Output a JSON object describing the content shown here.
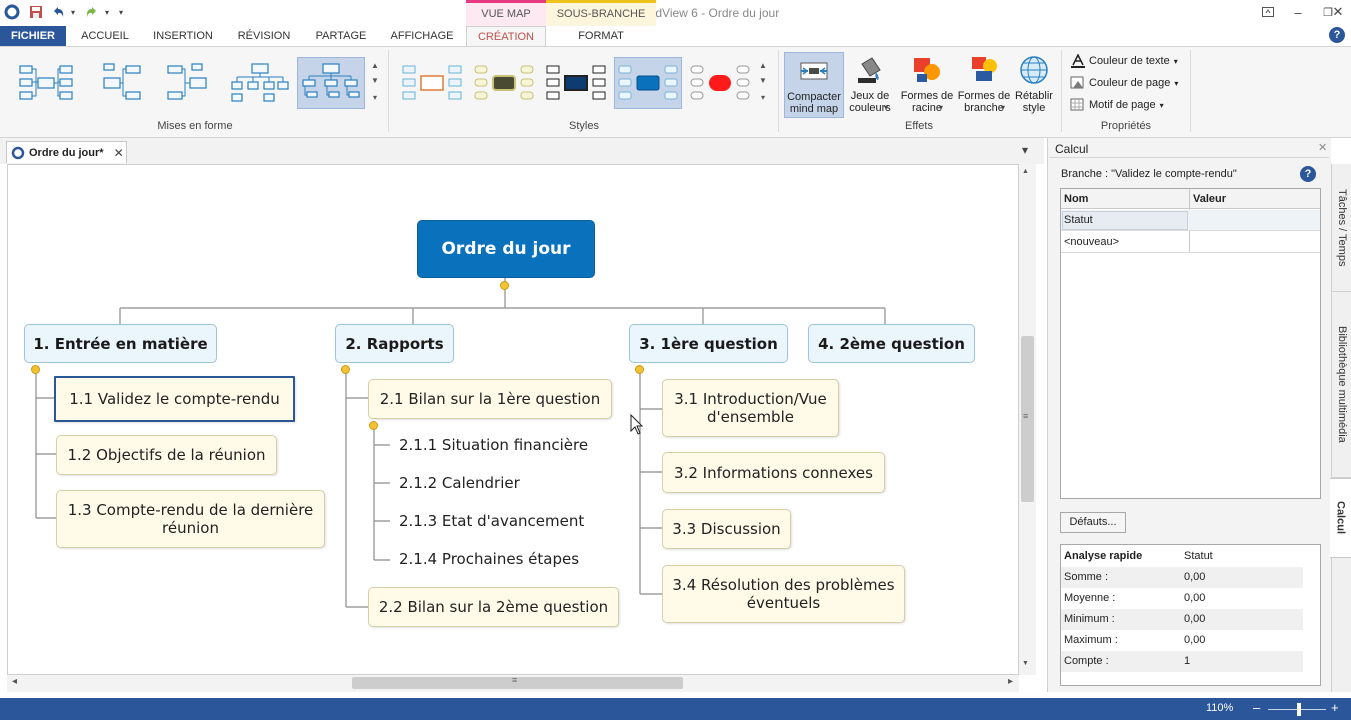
{
  "window": {
    "title": "MatchWare MindView 6 - Ordre du jour",
    "context_tabs": [
      "VUE MAP",
      "SOUS-BRANCHE"
    ],
    "minimize": "–",
    "restore": "❐",
    "close": "✕",
    "help": "?"
  },
  "tabs": [
    "FICHIER",
    "ACCUEIL",
    "INSERTION",
    "RÉVISION",
    "PARTAGE",
    "AFFICHAGE",
    "CRÉATION",
    "FORMAT"
  ],
  "ribbon": {
    "groups": {
      "layouts": "Mises en forme",
      "styles": "Styles",
      "effects": "Effets",
      "properties": "Propriétés"
    },
    "effects_buttons": [
      {
        "line1": "Compacter",
        "line2": "mind map"
      },
      {
        "line1": "Jeux de",
        "line2": "couleurs"
      },
      {
        "line1": "Formes de",
        "line2": "racine"
      },
      {
        "line1": "Formes de",
        "line2": "branche"
      },
      {
        "line1": "Rétablir",
        "line2": "style"
      }
    ],
    "dropdown_arrow": "▾",
    "property_buttons": [
      "Couleur de texte",
      "Couleur de page",
      "Motif de page"
    ],
    "scroll_up": "▲",
    "scroll_down": "▼",
    "scroll_more": "▾"
  },
  "document": {
    "tab_label": "Ordre du jour*",
    "tab_close": "✕",
    "strip_dropdown": "▾"
  },
  "mindmap": {
    "root": "Ordre du jour",
    "branches": [
      {
        "label": "1. Entrée en matière",
        "children": [
          {
            "label": "1.1  Validez le compte-rendu"
          },
          {
            "label": "1.2  Objectifs de la réunion"
          },
          {
            "line1": "1.3  Compte-rendu de la dernière",
            "line2": "réunion"
          }
        ]
      },
      {
        "label": "2. Rapports",
        "children": [
          {
            "label": "2.1  Bilan sur la 1ère question"
          },
          {
            "label": "2.2  Bilan sur la 2ème question"
          }
        ],
        "leaves": [
          "2.1.1  Situation financière",
          "2.1.2  Calendrier",
          "2.1.3  Etat d'avancement",
          "2.1.4  Prochaines étapes"
        ]
      },
      {
        "label": "3. 1ère question",
        "children": [
          {
            "line1": "3.1  Introduction/Vue",
            "line2": "d'ensemble"
          },
          {
            "label": "3.2  Informations connexes"
          },
          {
            "label": "3.3  Discussion"
          },
          {
            "line1": "3.4  Résolution des problèmes",
            "line2": "éventuels"
          }
        ]
      },
      {
        "label": "4. 2ème question"
      }
    ]
  },
  "scrollbars": {
    "up": "▲",
    "down": "▼",
    "left": "◂",
    "right": "▸",
    "grip": "≡"
  },
  "pane": {
    "title": "Calcul",
    "close": "✕",
    "branch_label": "Branche : \"Validez le compte-rendu\"",
    "help": "?",
    "table": {
      "headers": [
        "Nom",
        "Valeur"
      ],
      "rows": [
        [
          "Statut",
          ""
        ],
        [
          "<nouveau>",
          ""
        ]
      ]
    },
    "defaults_button": "Défauts...",
    "analysis": {
      "header": [
        "Analyse rapide",
        "Statut"
      ],
      "rows": [
        [
          "Somme :",
          "0,00"
        ],
        [
          "Moyenne :",
          "0,00"
        ],
        [
          "Minimum :",
          "0,00"
        ],
        [
          "Maximum :",
          "0,00"
        ],
        [
          "Compte :",
          "1"
        ]
      ]
    },
    "side_tabs": [
      "Tâches / Temps",
      "Bibliothèque multimédia",
      "Calcul"
    ]
  },
  "status": {
    "zoom": "110%",
    "zoom_out": "–",
    "zoom_in": "+"
  },
  "colors": {
    "accent": "#2b579a",
    "root_fill": "#0a72bd",
    "main_branch_fill": "#eaf6fc",
    "sub_branch_fill": "#fffbe8",
    "knob": "#f3c333"
  }
}
